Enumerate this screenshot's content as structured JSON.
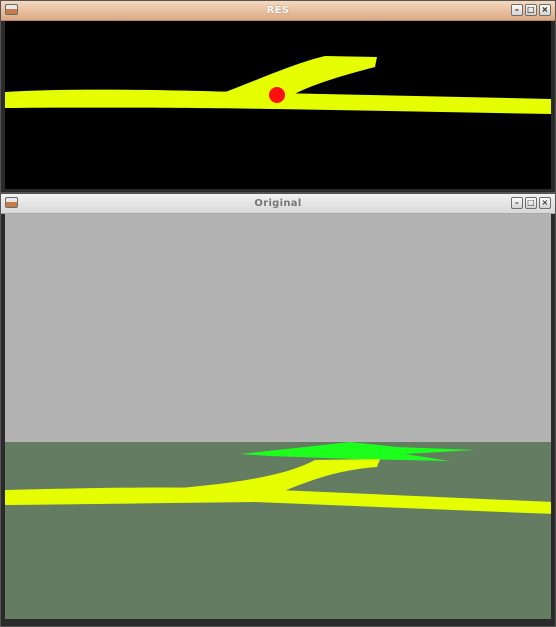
{
  "res_window": {
    "title": "RES",
    "menu_icon": "window-menu-icon",
    "buttons": {
      "minimize": "–",
      "maximize": "□",
      "close": "×"
    }
  },
  "original_window": {
    "title": "Original",
    "menu_icon": "window-menu-icon",
    "buttons": {
      "minimize": "–",
      "maximize": "□",
      "close": "×"
    }
  },
  "colors": {
    "res_background": "#000000",
    "line": "#e5ff00",
    "marker": "#ff1010",
    "sky": "#b3b3b3",
    "ground": "#647c62",
    "target": "#1cff1c"
  }
}
